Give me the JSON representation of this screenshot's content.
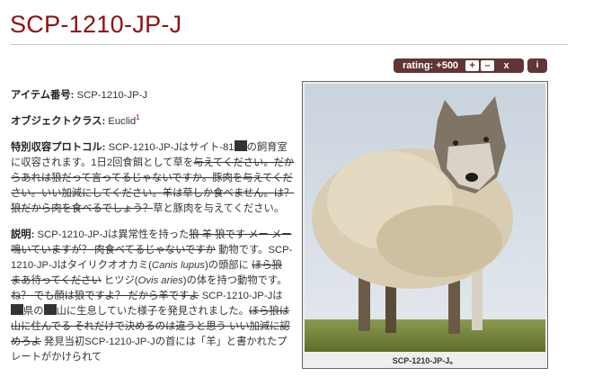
{
  "page": {
    "title": "SCP-1210-JP-J"
  },
  "rating": {
    "label": "rating: +500",
    "up": "+",
    "down": "–",
    "cancel": "x",
    "info": "i"
  },
  "item": {
    "label": "アイテム番号:",
    "value": "SCP-1210-JP-J"
  },
  "object_class": {
    "label": "オブジェクトクラス:",
    "value": "Euclid",
    "footnote": "1"
  },
  "containment": {
    "label": "特別収容プロトコル:",
    "t1": "SCP-1210-JP-Jはサイト-81",
    "t2": "の飼育室に収容されます。1日2回食餌として草を",
    "s1": "与えてください。だからあれは狼だって言ってるじゃないですか。豚肉を与えてください。いい加減にしてください。羊は草しか食べません。は？狼だから肉を食べるでしょう？",
    "t3": "草と豚肉を与えてください。"
  },
  "description": {
    "label": "説明:",
    "t1": "SCP-1210-JP-Jは異常性を持った",
    "s1": "狼 羊 狼です メー メー鳴いていますが？ 肉食べてるじゃないですか",
    "t2": " 動物です。SCP-1210-JP-Jはタイリクオオカミ(",
    "latin1": "Canis lupus",
    "t3": ")の頭部に ",
    "s2": "ほら狼 まあ待ってください",
    "t4": " ヒツジ(",
    "latin2": "Ovis aries",
    "t5": ")の体を持つ動物です。",
    "s3": "ね？ でも顔は狼ですよ？ だから羊ですよ",
    "t6": " SCP-1210-JP-Jは",
    "t7": "県の",
    "t8": "山に生息していた様子を発見されました。",
    "s4": "ほら狼は山に住んでる それだけで決めるのは違うと思う いい加減に認めろよ",
    "t9": " 発見当初SCP-1210-JP-Jの首には「羊」と書かれたプレートがかけられて"
  },
  "image": {
    "caption": "SCP-1210-JP-J。"
  }
}
